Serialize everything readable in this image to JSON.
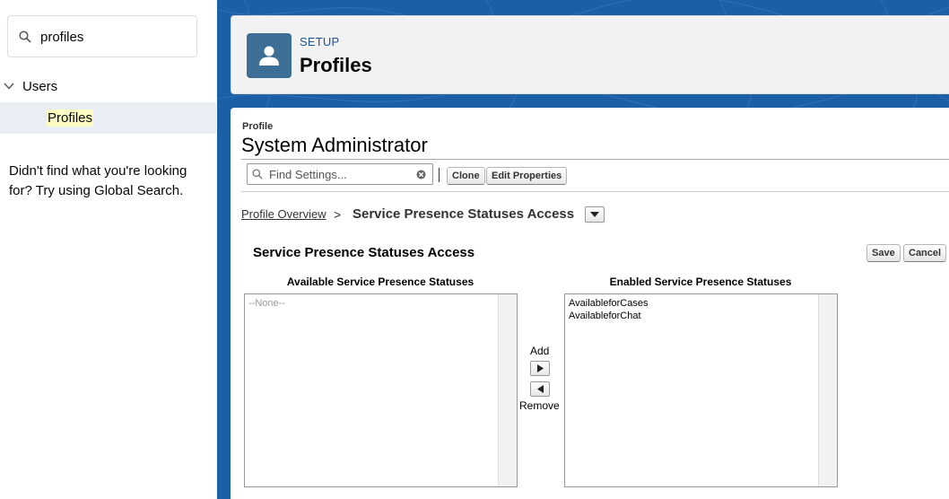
{
  "sidebar": {
    "search_value": "profiles",
    "tree": {
      "group_label": "Users",
      "item_label": "Profiles"
    },
    "help_text": "Didn't find what you're looking for? Try using Global Search."
  },
  "header": {
    "setup_label": "SETUP",
    "title": "Profiles",
    "icon": "user-icon"
  },
  "profile": {
    "label": "Profile",
    "name": "System Administrator",
    "find_placeholder": "Find Settings...",
    "buttons": {
      "clone": "Clone",
      "edit_properties": "Edit Properties"
    }
  },
  "breadcrumb": {
    "overview_link": "Profile Overview",
    "separator": ">",
    "current": "Service Presence Statuses Access"
  },
  "section": {
    "title": "Service Presence Statuses Access",
    "save_label": "Save",
    "cancel_label": "Cancel",
    "available_header": "Available Service Presence Statuses",
    "enabled_header": "Enabled Service Presence Statuses",
    "available_items": [
      "--None--"
    ],
    "enabled_items": [
      "AvailableforCases",
      "AvailableforChat"
    ],
    "add_label": "Add",
    "remove_label": "Remove"
  },
  "colors": {
    "brand_blue": "#1b5fa6",
    "header_icon_bg": "#3c6e96",
    "selected_row_bg": "#e8eef3",
    "highlight_bg": "#fdfcc3"
  }
}
